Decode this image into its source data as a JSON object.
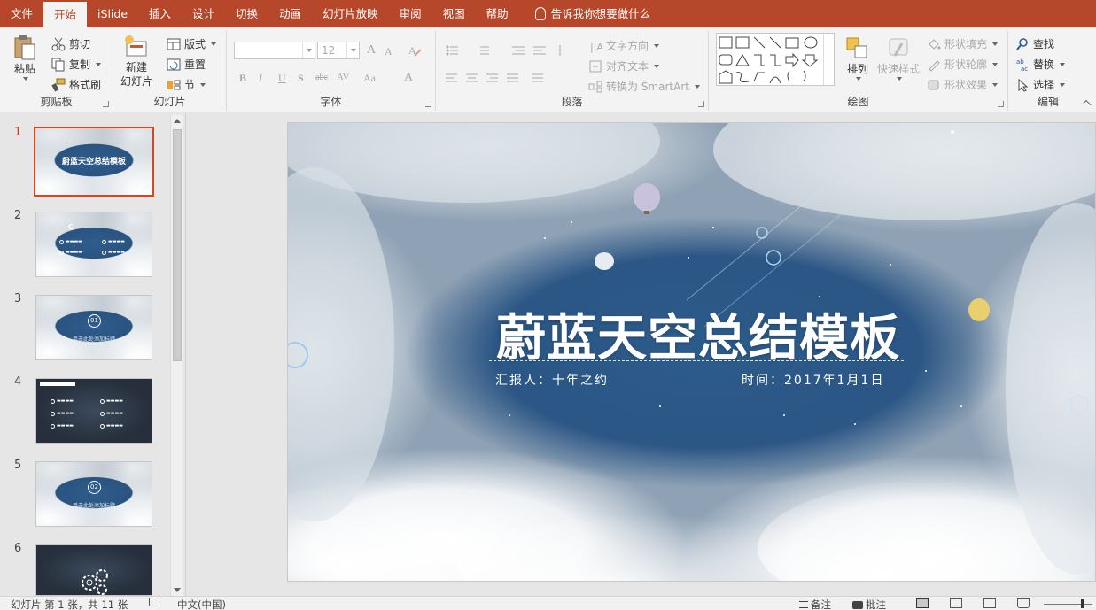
{
  "tabs": [
    "文件",
    "开始",
    "iSlide",
    "插入",
    "设计",
    "切换",
    "动画",
    "幻灯片放映",
    "审阅",
    "视图",
    "帮助"
  ],
  "active_tab": "开始",
  "tell_me": "告诉我你想要做什么",
  "ribbon": {
    "clipboard": {
      "label": "剪贴板",
      "paste": "粘贴",
      "cut": "剪切",
      "copy": "复制",
      "format_painter": "格式刷"
    },
    "slides": {
      "label": "幻灯片",
      "new_slide_line1": "新建",
      "new_slide_line2": "幻灯片",
      "layout": "版式",
      "reset": "重置",
      "section": "节"
    },
    "font": {
      "label": "字体",
      "font_name": "",
      "font_size": "12",
      "grow": "A",
      "shrink": "A",
      "bold": "B",
      "italic": "I",
      "underline": "U",
      "shadow": "S",
      "strike": "abc",
      "spacing": "AV",
      "case": "Aa",
      "color": "A"
    },
    "paragraph": {
      "label": "段落",
      "text_direction": "文字方向",
      "align_text": "对齐文本",
      "smartart": "转换为 SmartArt"
    },
    "drawing": {
      "label": "绘图",
      "arrange": "排列",
      "quick_styles": "快速样式",
      "shape_fill": "形状填充",
      "shape_outline": "形状轮廓",
      "shape_effects": "形状效果"
    },
    "editing": {
      "label": "编辑",
      "find": "查找",
      "replace": "替换",
      "select": "选择"
    }
  },
  "thumbnails": [
    {
      "num": "1",
      "title": "蔚蓝天空总结模板",
      "badge": "",
      "sub": "",
      "dark": false,
      "active": true
    },
    {
      "num": "2",
      "title": "",
      "badge": "",
      "sub": "",
      "dark": false,
      "active": false,
      "rows": true
    },
    {
      "num": "3",
      "title": "",
      "badge": "01",
      "sub": "单击此处添加标题",
      "dark": false,
      "active": false
    },
    {
      "num": "4",
      "title": "",
      "badge": "",
      "sub": "",
      "dark": true,
      "active": false,
      "rows": true
    },
    {
      "num": "5",
      "title": "",
      "badge": "02",
      "sub": "单击此处添加标题",
      "dark": false,
      "active": false
    },
    {
      "num": "6",
      "title": "",
      "badge": "",
      "sub": "",
      "dark": true,
      "active": false
    }
  ],
  "slide": {
    "title": "蔚蓝天空总结模板",
    "reporter": "汇报人：十年之约",
    "date": "时间：2017年1月1日"
  },
  "status": {
    "slide_info": "幻灯片 第 1 张，共 11 张",
    "language": "中文(中国)",
    "notes": "备注",
    "comments": "批注"
  },
  "colors": {
    "accent": "#b7472a",
    "thumb_active": "#d24726",
    "sky": "#2b5685"
  }
}
